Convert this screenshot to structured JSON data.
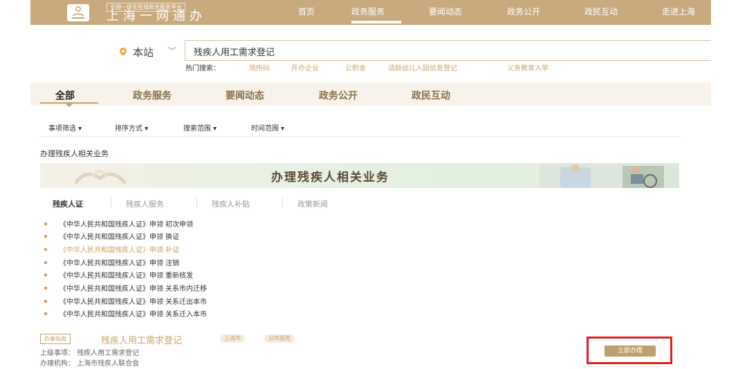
{
  "header": {
    "logo_icon": "stamp-icon",
    "subtitle": "全国一体化在线政务服务平台",
    "title": "上海一网通办",
    "nav": [
      "首页",
      "政务服务",
      "要闻动态",
      "政务公开",
      "政民互动",
      "走进上海"
    ],
    "active_nav": "政务服务"
  },
  "search": {
    "site_label": "本站",
    "site_icon": "location-pin-icon",
    "query": "残疾人用工需求登记",
    "hot_label": "热门搜索：",
    "hot_items": [
      "场所码",
      "开办企业",
      "公积金",
      "适龄幼儿入园信息登记",
      "义务教育入学"
    ]
  },
  "categories": [
    "全部",
    "政务服务",
    "要闻动态",
    "政务公开",
    "政民互动"
  ],
  "filters": [
    "事项筛选",
    "排序方式",
    "搜索范围",
    "时间范围"
  ],
  "section": {
    "title": "办理残疾人相关业务",
    "banner_title": "办理残疾人相关业务"
  },
  "sub_tabs": [
    "残疾人证",
    "残疾人服务",
    "残疾人补贴",
    "政策新闻"
  ],
  "list": [
    "《中华人民共和国残疾人证》申领 初次申领",
    "《中华人民共和国残疾人证》申领 换证",
    "《中华人民共和国残疾人证》申领 补证",
    "《中华人民共和国残疾人证》申领 注销",
    "《中华人民共和国残疾人证》申领 重新核发",
    "《中华人民共和国残疾人证》申领 关系市内迁移",
    "《中华人民共和国残疾人证》申领 关系迁出本市",
    "《中华人民共和国残疾人证》申领 关系迁入本市"
  ],
  "guide": {
    "badge": "办事指南",
    "title": "残疾人用工需求登记",
    "tags": [
      "上海市",
      "公共服务"
    ],
    "parent_label": "上级事项：",
    "parent_value": "残疾人用工需求登记",
    "org_label": "办理机构：",
    "org_value": "上海市残疾人联合会",
    "action": "立即办理"
  },
  "colors": {
    "accent": "#c8a46c",
    "header_bg": "#c8aa7e",
    "highlight": "#e0201c"
  }
}
